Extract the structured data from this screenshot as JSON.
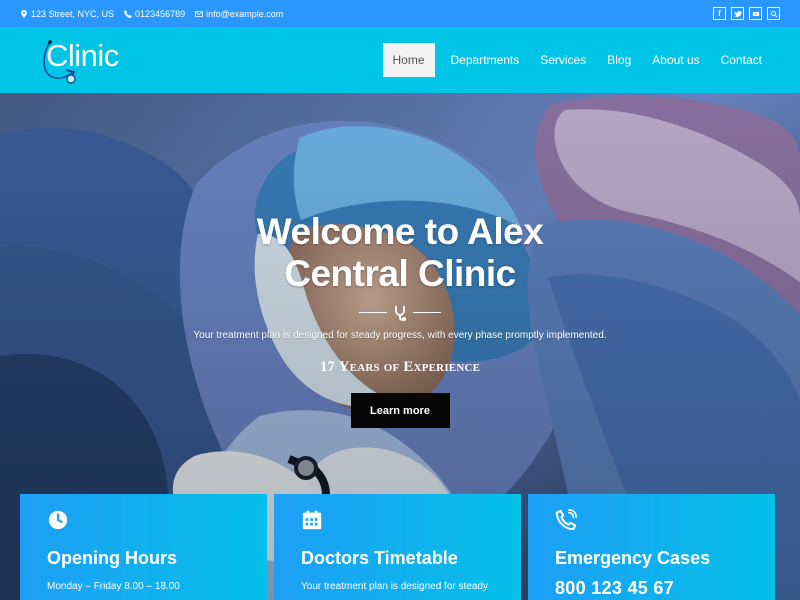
{
  "topbar": {
    "address": "123 Street, NYC, US",
    "phone": "0123456789",
    "email": "info@example.com",
    "social_icons": [
      "facebook-icon",
      "twitter-icon",
      "youtube-icon",
      "search-icon"
    ]
  },
  "brand": {
    "logo_text": "Clinic",
    "accent_color": "#01c5e6",
    "topbar_color": "#2a97ff"
  },
  "nav": {
    "items": [
      {
        "label": "Home",
        "active": true
      },
      {
        "label": "Departments",
        "active": false
      },
      {
        "label": "Services",
        "active": false
      },
      {
        "label": "Blog",
        "active": false
      },
      {
        "label": "About us",
        "active": false
      },
      {
        "label": "Contact",
        "active": false
      }
    ]
  },
  "hero": {
    "title_line_1": "Welcome to Alex",
    "title_line_2": "Central Clinic",
    "description": "Your treatment plan is designed for steady progress, with every phase promptly implemented.",
    "experience": "17 Years of Experience",
    "button_label": "Learn more",
    "divider_icon": "stethoscope-icon"
  },
  "cards": [
    {
      "icon": "clock-icon",
      "title": "Opening Hours",
      "line": "Monday – Friday 8.00 – 18.00"
    },
    {
      "icon": "calendar-icon",
      "title": "Doctors Timetable",
      "line": "Your treatment plan is designed for steady"
    },
    {
      "icon": "phone-icon",
      "title": "Emergency Cases",
      "line": "800 123 45 67"
    }
  ]
}
